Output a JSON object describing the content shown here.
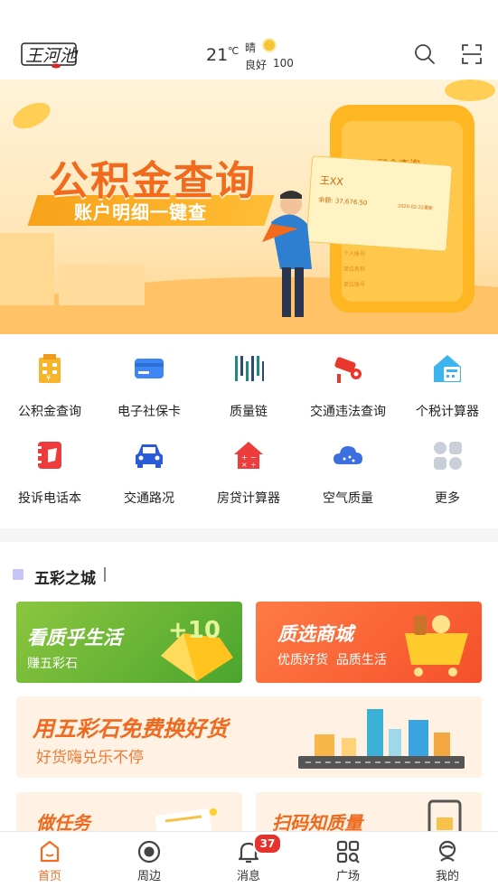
{
  "header": {
    "logo_text": "王河池",
    "weather": {
      "temp": "21",
      "unit": "℃",
      "condition": "晴",
      "air_label": "良好",
      "air_value": "100"
    },
    "icons": [
      "search-icon",
      "scan-icon"
    ]
  },
  "banner": {
    "title": "公积金查询",
    "subtitle": "账户明细一键查",
    "phone_title": "公积金查询",
    "card_name": "王XX",
    "card_amount": "余额: 37,676.50",
    "card_date": "2020-02-22更新",
    "rows": [
      "个人账号",
      "单位名称",
      "单位账号"
    ]
  },
  "services": [
    {
      "label": "公积金查询",
      "icon": "building-icon"
    },
    {
      "label": "电子社保卡",
      "icon": "card-icon"
    },
    {
      "label": "质量链",
      "icon": "barcode-icon"
    },
    {
      "label": "交通违法查询",
      "icon": "camera-icon"
    },
    {
      "label": "个税计算器",
      "icon": "calculator-house-icon"
    },
    {
      "label": "投诉电话本",
      "icon": "phone-book-icon"
    },
    {
      "label": "交通路况",
      "icon": "car-icon"
    },
    {
      "label": "房贷计算器",
      "icon": "house-calc-icon"
    },
    {
      "label": "空气质量",
      "icon": "cloud-icon"
    },
    {
      "label": "更多",
      "icon": "more-icon"
    }
  ],
  "section": {
    "title": "五彩之城",
    "cards": [
      {
        "title": "看质乎生活",
        "subtitle": "赚五彩石",
        "badge": "+10"
      },
      {
        "title": "质选商城",
        "subtitle": "优质好货  品质生活"
      },
      {
        "title": "用五彩石免费换好货",
        "subtitle": "好货嗨兑乐不停"
      },
      {
        "title": "做任务"
      },
      {
        "title": "扫码知质量"
      }
    ]
  },
  "tabbar": {
    "tabs": [
      {
        "label": "首页",
        "icon": "home-icon",
        "active": true
      },
      {
        "label": "周边",
        "icon": "nearby-icon"
      },
      {
        "label": "消息",
        "icon": "bell-icon"
      },
      {
        "label": "广场",
        "icon": "square-grid-icon"
      },
      {
        "label": "我的",
        "icon": "profile-icon"
      }
    ],
    "message_badge": "37"
  },
  "colors": {
    "accent": "#f36b21",
    "banner_orange": "#f26a1b",
    "badge_red": "#e5322d"
  }
}
